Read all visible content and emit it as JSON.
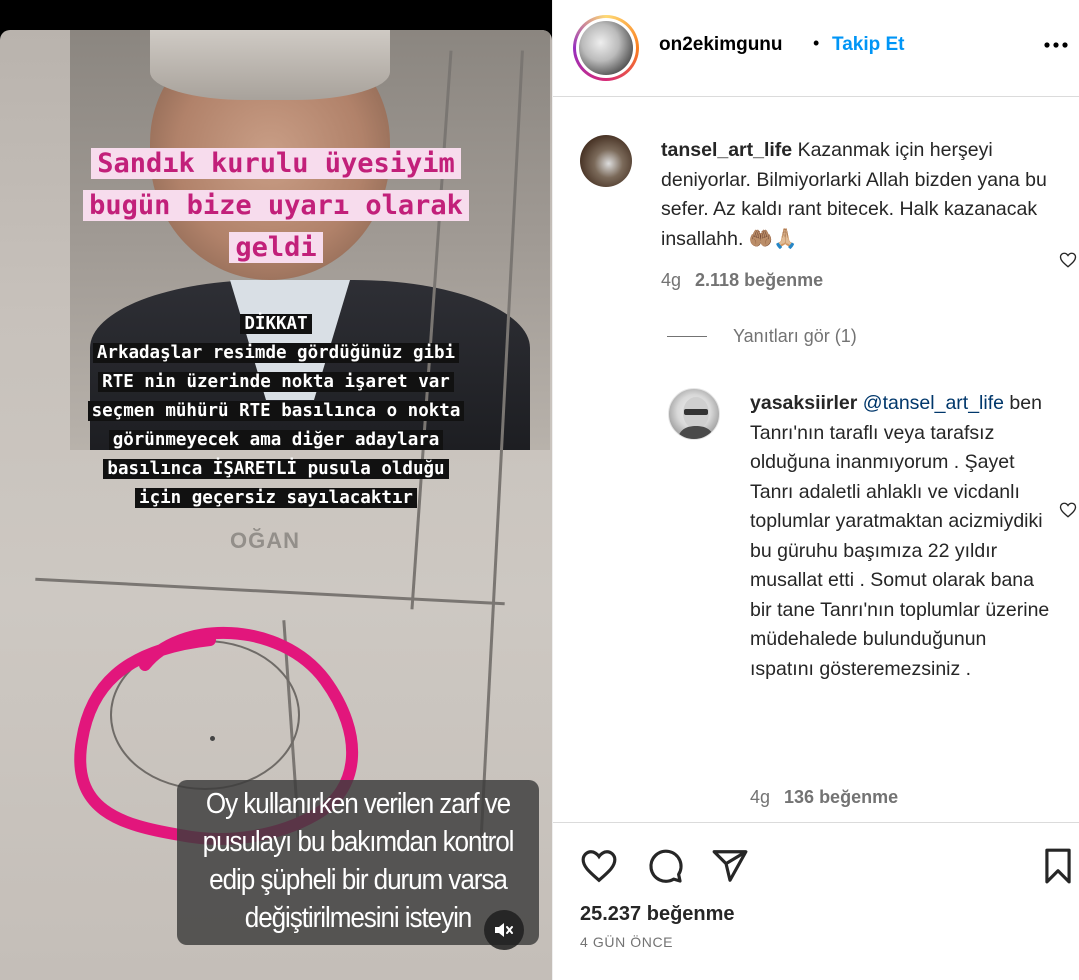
{
  "story": {
    "pink_title_lines": [
      "Sandık kurulu üyesiyim",
      "bugün bize uyarı olarak",
      "geldi"
    ],
    "warning_lines": [
      "DİKKAT",
      "Arkadaşlar resimde gördüğünüz gibi",
      "RTE nin üzerinde nokta işaret var",
      "seçmen mühürü RTE basılınca o nokta",
      "görünmeyecek ama diğer adaylara",
      "basılınca İŞARETLİ pusula olduğu",
      "için geçersiz sayılacaktır"
    ],
    "ballot_name": "OĞAN",
    "subtitle_lines": [
      "Oy kullanırken verilen zarf ve",
      "pusulayı bu bakımdan kontrol",
      "edip şüpheli bir durum varsa",
      "değiştirilmesini isteyin"
    ],
    "mute_icon": "speaker-muted-icon"
  },
  "header": {
    "username": "on2ekimgunu",
    "separator": "•",
    "follow_label": "Takip Et",
    "more_icon": "more-horizontal-icon"
  },
  "comments": [
    {
      "username": "tansel_art_life",
      "text": "Kazanmak için herşeyi deniyorlar. Bilmiyorlarki Allah bizden yana bu sefer. Az kaldı rant bitecek. Halk kazanacak insallahh. 🤲🏽🙏🏼",
      "time": "4g",
      "likes": "2.118 beğenme"
    }
  ],
  "view_replies": "Yanıtları gör (1)",
  "reply": {
    "username": "yasaksiirler",
    "mention": "@tansel_art_life",
    "text": "ben Tanrı'nın taraflı veya tarafsız olduğuna inanmıyorum . Şayet Tanrı adaletli ahlaklı ve vicdanlı toplumlar yaratmaktan acizmiydiki bu güruhu başımıza 22 yıldır musallat etti . Somut olarak bana bir tane Tanrı'nın toplumlar üzerine müdehalede bulunduğunun ıspatını gösteremezsiniz .",
    "time": "4g",
    "likes": "136 beğenme"
  },
  "footer": {
    "likes": "25.237 beğenme",
    "date": "4 GÜN ÖNCE",
    "icons": [
      "heart-icon",
      "comment-icon",
      "share-icon",
      "bookmark-icon"
    ]
  },
  "colors": {
    "follow": "#0095f6",
    "pink": "#c2207a",
    "mention": "#00376b",
    "secondary_text": "#737373"
  }
}
